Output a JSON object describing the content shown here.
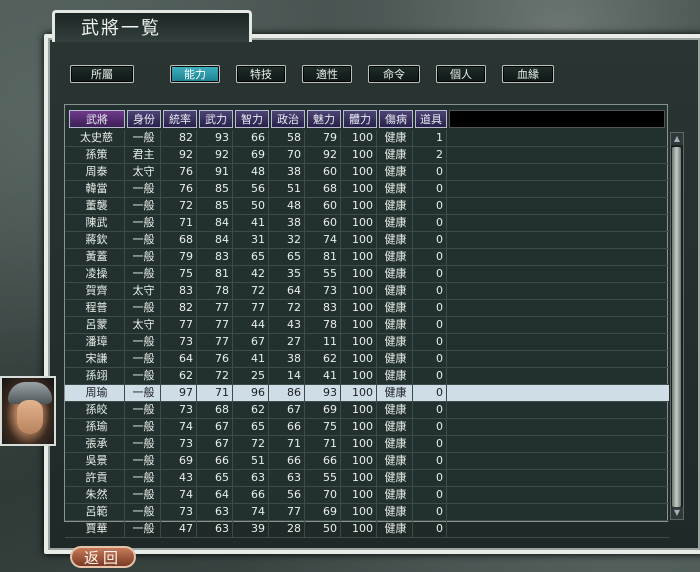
{
  "window": {
    "title": "武將一覧"
  },
  "tabs": [
    {
      "label": "所屬",
      "active": false
    },
    {
      "label": "能力",
      "active": true
    },
    {
      "label": "特技",
      "active": false
    },
    {
      "label": "適性",
      "active": false
    },
    {
      "label": "命令",
      "active": false
    },
    {
      "label": "個人",
      "active": false
    },
    {
      "label": "血緣",
      "active": false
    }
  ],
  "table": {
    "headers": [
      "武將",
      "身份",
      "統率",
      "武力",
      "智力",
      "政治",
      "魅力",
      "體力",
      "傷病",
      "道具"
    ],
    "sorted_column": "武將",
    "selected_row_index": 15,
    "rows": [
      [
        "太史慈",
        "一般",
        "82",
        "93",
        "66",
        "58",
        "79",
        "100",
        "健康",
        "1"
      ],
      [
        "孫策",
        "君主",
        "92",
        "92",
        "69",
        "70",
        "92",
        "100",
        "健康",
        "2"
      ],
      [
        "周泰",
        "太守",
        "76",
        "91",
        "48",
        "38",
        "60",
        "100",
        "健康",
        "0"
      ],
      [
        "韓當",
        "一般",
        "76",
        "85",
        "56",
        "51",
        "68",
        "100",
        "健康",
        "0"
      ],
      [
        "董襲",
        "一般",
        "72",
        "85",
        "50",
        "48",
        "60",
        "100",
        "健康",
        "0"
      ],
      [
        "陳武",
        "一般",
        "71",
        "84",
        "41",
        "38",
        "60",
        "100",
        "健康",
        "0"
      ],
      [
        "蔣欽",
        "一般",
        "68",
        "84",
        "31",
        "32",
        "74",
        "100",
        "健康",
        "0"
      ],
      [
        "黃蓋",
        "一般",
        "79",
        "83",
        "65",
        "65",
        "81",
        "100",
        "健康",
        "0"
      ],
      [
        "凌操",
        "一般",
        "75",
        "81",
        "42",
        "35",
        "55",
        "100",
        "健康",
        "0"
      ],
      [
        "賀齊",
        "太守",
        "83",
        "78",
        "72",
        "64",
        "73",
        "100",
        "健康",
        "0"
      ],
      [
        "程普",
        "一般",
        "82",
        "77",
        "77",
        "72",
        "83",
        "100",
        "健康",
        "0"
      ],
      [
        "呂蒙",
        "太守",
        "77",
        "77",
        "44",
        "43",
        "78",
        "100",
        "健康",
        "0"
      ],
      [
        "潘璋",
        "一般",
        "73",
        "77",
        "67",
        "27",
        "11",
        "100",
        "健康",
        "0"
      ],
      [
        "宋謙",
        "一般",
        "64",
        "76",
        "41",
        "38",
        "62",
        "100",
        "健康",
        "0"
      ],
      [
        "孫翊",
        "一般",
        "62",
        "72",
        "25",
        "14",
        "41",
        "100",
        "健康",
        "0"
      ],
      [
        "周瑜",
        "一般",
        "97",
        "71",
        "96",
        "86",
        "93",
        "100",
        "健康",
        "0"
      ],
      [
        "孫皎",
        "一般",
        "73",
        "68",
        "62",
        "67",
        "69",
        "100",
        "健康",
        "0"
      ],
      [
        "孫瑜",
        "一般",
        "74",
        "67",
        "65",
        "66",
        "75",
        "100",
        "健康",
        "0"
      ],
      [
        "張承",
        "一般",
        "73",
        "67",
        "72",
        "71",
        "71",
        "100",
        "健康",
        "0"
      ],
      [
        "吳景",
        "一般",
        "69",
        "66",
        "51",
        "66",
        "66",
        "100",
        "健康",
        "0"
      ],
      [
        "許貢",
        "一般",
        "43",
        "65",
        "63",
        "63",
        "55",
        "100",
        "健康",
        "0"
      ],
      [
        "朱然",
        "一般",
        "74",
        "64",
        "66",
        "56",
        "70",
        "100",
        "健康",
        "0"
      ],
      [
        "呂範",
        "一般",
        "73",
        "63",
        "74",
        "77",
        "69",
        "100",
        "健康",
        "0"
      ],
      [
        "賈華",
        "一般",
        "47",
        "63",
        "39",
        "28",
        "50",
        "100",
        "健康",
        "0"
      ]
    ]
  },
  "portrait": {
    "icon": "general-portrait"
  },
  "footer": {
    "back_label": "返回"
  }
}
